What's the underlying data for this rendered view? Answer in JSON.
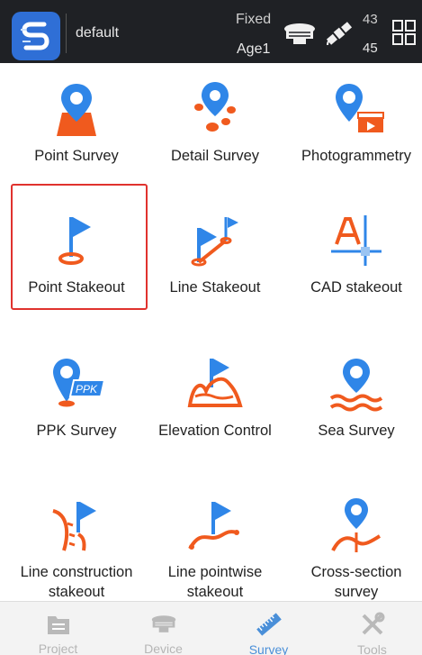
{
  "status_bar": {
    "project_name": "default",
    "fix_status": "Fixed",
    "age": "Age1",
    "satellites_top": "43",
    "satellites_bottom": "45"
  },
  "survey_items": [
    {
      "label": "Point Survey",
      "icon": "point-survey-icon"
    },
    {
      "label": "Detail Survey",
      "icon": "detail-survey-icon"
    },
    {
      "label": "Photogrammetry",
      "icon": "photogrammetry-icon"
    },
    {
      "label": "Point Stakeout",
      "icon": "point-stakeout-icon",
      "selected": true
    },
    {
      "label": "Line Stakeout",
      "icon": "line-stakeout-icon"
    },
    {
      "label": "CAD stakeout",
      "icon": "cad-stakeout-icon"
    },
    {
      "label": "PPK Survey",
      "icon": "ppk-survey-icon",
      "badge": "PPK"
    },
    {
      "label": "Elevation Control",
      "icon": "elevation-control-icon"
    },
    {
      "label": "Sea Survey",
      "icon": "sea-survey-icon"
    },
    {
      "label_line1": "Line construction",
      "label_line2": "stakeout",
      "icon": "line-construction-stakeout-icon"
    },
    {
      "label_line1": "Line pointwise",
      "label_line2": "stakeout",
      "icon": "line-pointwise-stakeout-icon"
    },
    {
      "label_line1": "Cross-section",
      "label_line2": "survey",
      "icon": "cross-section-survey-icon"
    }
  ],
  "bottom_nav": [
    {
      "label": "Project",
      "icon": "project-icon",
      "active": false
    },
    {
      "label": "Device",
      "icon": "device-icon",
      "active": false
    },
    {
      "label": "Survey",
      "icon": "survey-icon",
      "active": true
    },
    {
      "label": "Tools",
      "icon": "tools-icon",
      "active": false
    }
  ],
  "colors": {
    "accent_blue": "#2f86e8",
    "accent_orange": "#f05a1e",
    "highlight_red": "#e0322e",
    "topbar_bg": "#1f2125"
  }
}
